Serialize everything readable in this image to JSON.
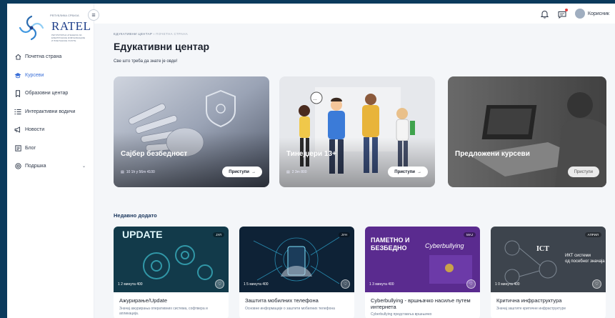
{
  "logo": {
    "top": "РЕПУБЛИКА СРБИЈА",
    "name": "RATEL",
    "sub": "РЕГУЛАТОРНА АГЕНЦИЈА ЗА ЕЛЕКТРОНСКЕ КОМУНИКАЦИЈЕ И ПОШТАНСКЕ УСЛУГЕ"
  },
  "sidebar": {
    "items": [
      {
        "label": "Почетна страна",
        "icon": "home-icon"
      },
      {
        "label": "Курсеви",
        "icon": "graduation-cap-icon",
        "active": true
      },
      {
        "label": "Образовни центар",
        "icon": "bookmark-icon"
      },
      {
        "label": "Интерактивни водичи",
        "icon": "list-icon"
      },
      {
        "label": "Новости",
        "icon": "megaphone-icon"
      },
      {
        "label": "Блог",
        "icon": "blog-icon"
      },
      {
        "label": "Подршка",
        "icon": "support-icon"
      }
    ]
  },
  "topbar": {
    "user_label": "Корисник"
  },
  "breadcrumb": {
    "root": "ЕДУКАТИВНИ ЦЕНТАР",
    "separator": "›",
    "current": "ПОЧЕТНА СТРАНА"
  },
  "page": {
    "title": "Едукативни центар",
    "subtitle": "Све што треба да знате је овде!"
  },
  "heroes": [
    {
      "title": "Сајбер безбедност",
      "meta": "10  1h y 56m  4100",
      "button": "Приступи",
      "arrow": "→"
    },
    {
      "title": "Тинејџери 13+",
      "meta": "2  3m  800",
      "button": "Приступи",
      "arrow": "→"
    },
    {
      "title": "Предложени курсеви",
      "meta": "",
      "button": "Приступи",
      "arrow": ""
    }
  ],
  "recent": {
    "title": "Недавно додато",
    "cards": [
      {
        "tag": "ЈУЛ",
        "meta": "1  2 минута  400",
        "title": "Ажурирање/Update",
        "desc": "Значај ажурирања оперативних система, софтвера и апликација.",
        "overlay": "UPDATE"
      },
      {
        "tag": "ЈУН",
        "meta": "1  5 минута  400",
        "title": "Заштита мобилних телефона",
        "desc": "Основне информације о заштити мобилних телефона",
        "overlay": ""
      },
      {
        "tag": "МАЈ",
        "meta": "1  3 минута  400",
        "title": "Cyberbullying - вршњачко насиље путем интернета",
        "desc": "Cyberbullying представља вршњачко",
        "overlay": "ПАМЕТНО И БЕЗБЕДНО",
        "overlay2": "Cyberbullying"
      },
      {
        "tag": "АПРИЛ",
        "meta": "1  0 минута  400",
        "title": "Критична инфраструктура",
        "desc": "Значај заштите критичне инфраструктуре",
        "overlay": "ICT",
        "overlay2": "ИКТ системи од посебног значаја"
      }
    ]
  },
  "colors": {
    "accent": "#3a6fd8",
    "page_bg": "#0b3a5c"
  }
}
